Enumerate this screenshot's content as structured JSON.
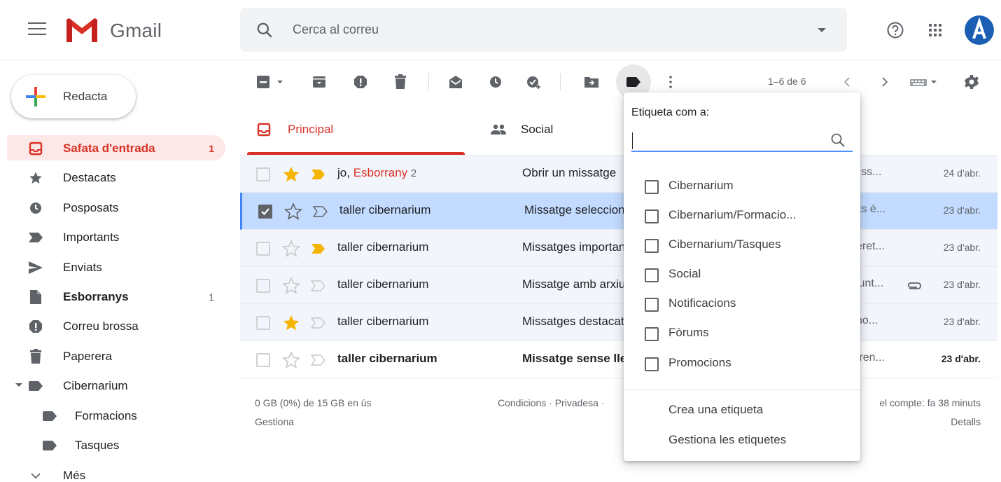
{
  "app": {
    "logo_text": "Gmail",
    "search_placeholder": "Cerca al correu"
  },
  "sidebar": {
    "compose_label": "Redacta",
    "items": [
      {
        "label": "Safata d'entrada",
        "count": "1",
        "icon": "inbox-icon"
      },
      {
        "label": "Destacats",
        "count": "",
        "icon": "star-icon"
      },
      {
        "label": "Posposats",
        "count": "",
        "icon": "clock-icon"
      },
      {
        "label": "Importants",
        "count": "",
        "icon": "important-icon"
      },
      {
        "label": "Enviats",
        "count": "",
        "icon": "send-icon"
      },
      {
        "label": "Esborranys",
        "count": "1",
        "icon": "draft-icon"
      },
      {
        "label": "Correu brossa",
        "count": "",
        "icon": "spam-icon"
      },
      {
        "label": "Paperera",
        "count": "",
        "icon": "trash-icon"
      },
      {
        "label": "Cibernarium",
        "count": "",
        "icon": "label-icon"
      },
      {
        "label": "Formacions",
        "count": "",
        "icon": "label-icon"
      },
      {
        "label": "Tasques",
        "count": "",
        "icon": "label-icon"
      },
      {
        "label": "Més",
        "count": "",
        "icon": "chevron-down-icon"
      }
    ]
  },
  "toolbar": {
    "page_info": "1–6 de 6"
  },
  "tabs": [
    {
      "label": "Principal",
      "icon": "inbox-icon",
      "active": true
    },
    {
      "label": "Social",
      "icon": "people-icon",
      "active": false
    }
  ],
  "emails": [
    {
      "sender": "jo,",
      "draft_label": "Esborrany",
      "draft_count": "2",
      "subject": "Obrir un missatge",
      "snippet": "liss...",
      "date": "24 d'abr.",
      "starred": true,
      "important": true,
      "selected": false,
      "unread": false,
      "attachment": false
    },
    {
      "sender": "taller cibernarium",
      "draft_label": "",
      "draft_count": "",
      "subject": "Missatge seleccionat",
      "snippet": "ts é...",
      "date": "23 d'abr.",
      "starred": false,
      "important": false,
      "selected": true,
      "unread": false,
      "attachment": false
    },
    {
      "sender": "taller cibernarium",
      "draft_label": "",
      "draft_count": "",
      "subject": "Missatges importants",
      "snippet": "eret...",
      "date": "23 d'abr.",
      "starred": false,
      "important": true,
      "selected": false,
      "unread": false,
      "attachment": false
    },
    {
      "sender": "taller cibernarium",
      "draft_label": "",
      "draft_count": "",
      "subject": "Missatge amb arxiu",
      "snippet": "junt...",
      "date": "23 d'abr.",
      "starred": false,
      "important": false,
      "selected": false,
      "unread": false,
      "attachment": true
    },
    {
      "sender": "taller cibernarium",
      "draft_label": "",
      "draft_count": "",
      "subject": "Missatges destacats",
      "snippet": "no...",
      "date": "23 d'abr.",
      "starred": true,
      "important": false,
      "selected": false,
      "unread": false,
      "attachment": false
    },
    {
      "sender": "taller cibernarium",
      "draft_label": "",
      "draft_count": "",
      "subject": "Missatge sense llegir",
      "snippet": "tren...",
      "date": "23 d'abr.",
      "starred": false,
      "important": false,
      "selected": false,
      "unread": true,
      "attachment": false
    }
  ],
  "footer": {
    "storage": "0 GB (0%) de 15 GB en ús",
    "manage": "Gestiona",
    "links": "Condicions · Privadesa ·",
    "activity": "el compte: fa 38 minuts",
    "details": "Detalls"
  },
  "label_menu": {
    "title": "Etiqueta com a:",
    "options": [
      "Cibernarium",
      "Cibernarium/Formacio...",
      "Cibernarium/Tasques",
      "Social",
      "Notificacions",
      "Fòrums",
      "Promocions"
    ],
    "create": "Crea una etiqueta",
    "manage": "Gestiona les etiquetes"
  },
  "colors": {
    "accent_red": "#d93025",
    "selected_row": "#c2dbff",
    "star_yellow": "#f4b400",
    "input_blue": "#4d90fe"
  }
}
